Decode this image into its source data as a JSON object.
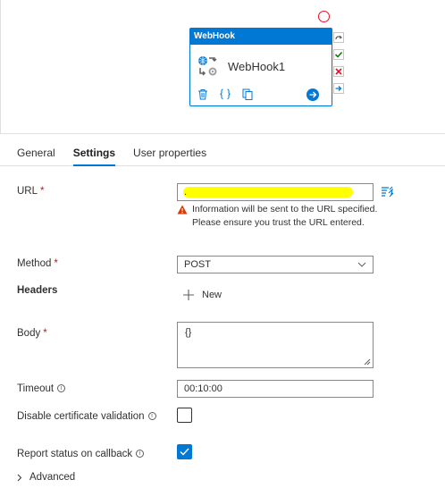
{
  "activity": {
    "header": "WebHook",
    "name": "WebHook1"
  },
  "tabs": [
    {
      "label": "General"
    },
    {
      "label": "Settings"
    },
    {
      "label": "User properties"
    }
  ],
  "active_tab": "Settings",
  "form": {
    "url": {
      "label": "URL",
      "required_mark": "*",
      "value": ".",
      "warning": "Information will be sent to the URL specified. Please ensure you trust the URL entered."
    },
    "method": {
      "label": "Method",
      "required_mark": "*",
      "value": "POST"
    },
    "headers": {
      "label": "Headers",
      "new_label": "New"
    },
    "body": {
      "label": "Body",
      "required_mark": "*",
      "value": "{}"
    },
    "timeout": {
      "label": "Timeout",
      "value": "00:10:00"
    },
    "disable_cert": {
      "label": "Disable certificate validation",
      "checked": false
    },
    "report_status": {
      "label": "Report status on callback",
      "checked": true
    },
    "advanced_label": "Advanced"
  },
  "colors": {
    "accent": "#0078d4",
    "required": "#a4262c",
    "success": "#107c10",
    "error": "#e81123",
    "warning": "#d83b01"
  }
}
